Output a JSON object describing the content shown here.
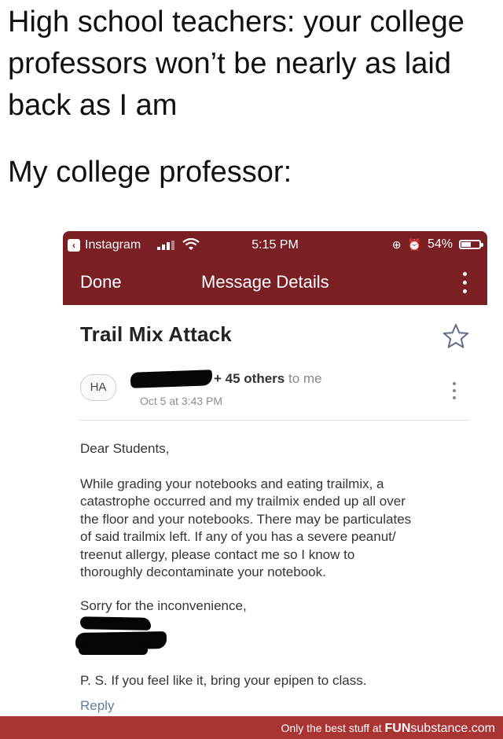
{
  "meme": {
    "line1": "High school teachers: your college",
    "line2": "professors won’t be nearly as laid",
    "line3": "back as I am",
    "line4": "My college professor:"
  },
  "status_bar": {
    "app_back_label": "Instagram",
    "time": "5:15 PM",
    "battery": "54%",
    "battery_level": 0.54
  },
  "nav": {
    "done_label": "Done",
    "title": "Message Details"
  },
  "email": {
    "subject": "Trail Mix Attack",
    "avatar_initials": "HA",
    "recipients": "+ 45 others",
    "to_me": "to me",
    "date": "Oct 5 at 3:43 PM",
    "greeting": "Dear Students,",
    "paragraph": "While grading your notebooks and eating trailmix, a\ncatastrophe occurred and my trailmix ended up all over\nthe floor and your notebooks. There may be particulates\nof said trailmix left. If any of you has a severe peanut/\ntreenut allergy, please contact me so I know  to\nthoroughly decontaminate your notebook.",
    "sorry": "Sorry for the inconvenience,",
    "ps": "P. S. If you feel like it, bring your epipen to class.",
    "reply_label": "Reply"
  },
  "watermark": {
    "text": "Only the best stuff at",
    "brand_bold": "FUN",
    "brand_rest": "substance.com"
  },
  "colors": {
    "header_red": "#7a1f24",
    "watermark_red": "#aa3333",
    "link_blue": "#5a7fa8"
  }
}
